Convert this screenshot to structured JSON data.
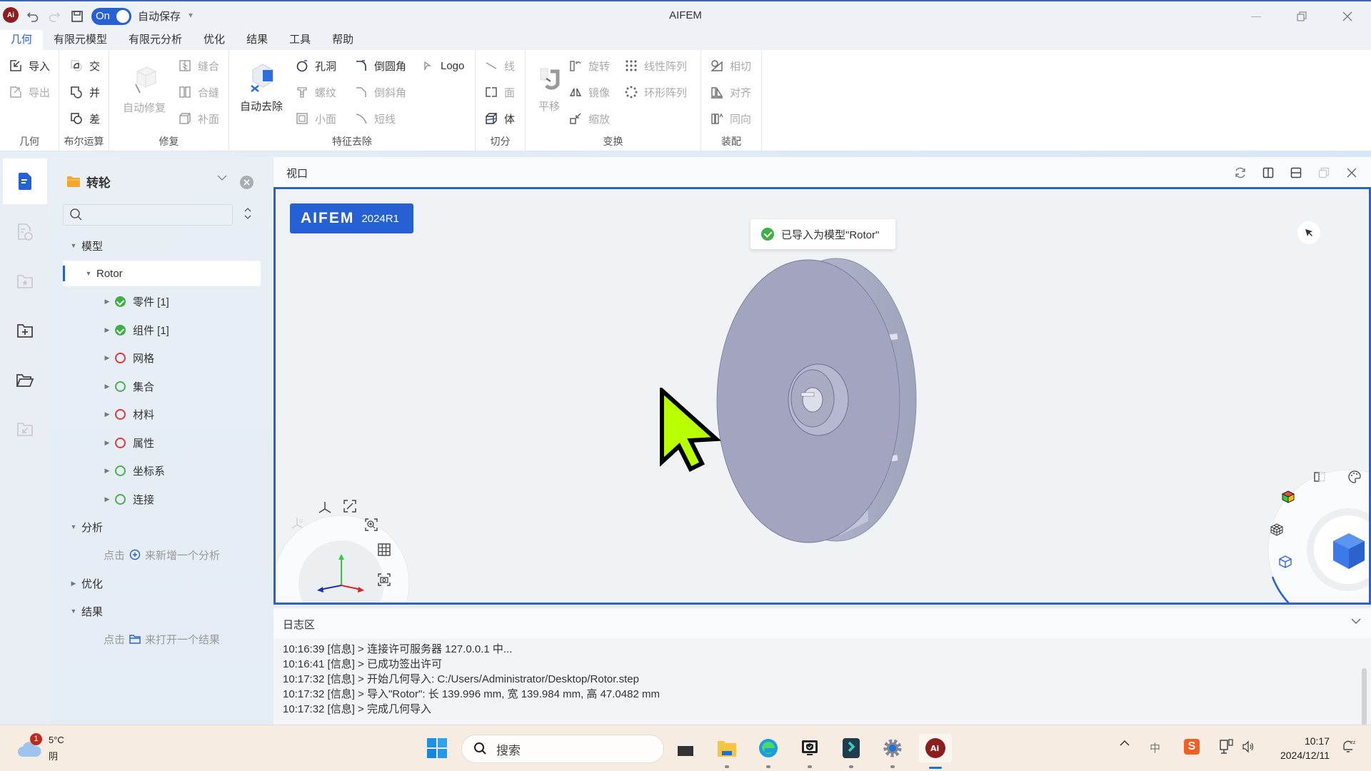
{
  "titlebar": {
    "app_title": "AIFEM",
    "autosave_toggle": "On",
    "autosave_label": "自动保存"
  },
  "menu": [
    "几何",
    "有限元模型",
    "有限元分析",
    "优化",
    "结果",
    "工具",
    "帮助"
  ],
  "ribbon": {
    "geometry": {
      "label": "几何",
      "import": "导入",
      "export": "导出"
    },
    "boolean": {
      "label": "布尔运算",
      "intersect": "交",
      "union": "并",
      "subtract": "差"
    },
    "repair": {
      "label": "修复",
      "auto_repair": "自动修复",
      "stitch": "缝合",
      "merge_seam": "合缝",
      "patch": "补面"
    },
    "feature_removal": {
      "label": "特征去除",
      "auto_remove": "自动去除",
      "hole": "孔洞",
      "thread": "螺纹",
      "small_face": "小面",
      "fillet": "倒圆角",
      "chamfer": "倒斜角",
      "short_edge": "短线",
      "logo": "Logo"
    },
    "split": {
      "label": "切分",
      "line": "线",
      "face": "面",
      "body": "体"
    },
    "transform": {
      "label": "变换",
      "translate": "平移",
      "rotate": "旋转",
      "mirror": "镜像",
      "scale": "缩放",
      "linear_array": "线性阵列",
      "circular_array": "环形阵列"
    },
    "assembly": {
      "label": "装配",
      "tangent": "相切",
      "align": "对齐",
      "same_direction": "同向"
    }
  },
  "tree": {
    "project": "转轮",
    "search_placeholder": "",
    "model_section": "模型",
    "root": "Rotor",
    "children": [
      {
        "label": "零件 [1]",
        "status": "ok"
      },
      {
        "label": "组件 [1]",
        "status": "ok"
      },
      {
        "label": "网格",
        "status": "red"
      },
      {
        "label": "集合",
        "status": "green"
      },
      {
        "label": "材料",
        "status": "red"
      },
      {
        "label": "属性",
        "status": "red"
      },
      {
        "label": "坐标系",
        "status": "green"
      },
      {
        "label": "连接",
        "status": "green"
      }
    ],
    "analysis_section": "分析",
    "analysis_hint_pre": "点击",
    "analysis_hint_post": "来新增一个分析",
    "optimization_section": "优化",
    "results_section": "结果",
    "results_hint_pre": "点击",
    "results_hint_post": "来打开一个结果"
  },
  "viewport": {
    "title": "视口",
    "brand_name": "AIFEM",
    "brand_version": "2024R1",
    "toast": "已导入为模型\"Rotor\""
  },
  "log": {
    "title": "日志区",
    "lines": [
      "10:16:39 [信息] > 连接许可服务器 127.0.0.1 中...",
      "10:16:41 [信息] > 已成功签出许可",
      "10:17:32 [信息] > 开始几何导入: C:/Users/Administrator/Desktop/Rotor.step",
      "10:17:32 [信息] > 导入\"Rotor\": 长 139.996 mm, 宽 139.984 mm, 高 47.0482 mm",
      "10:17:32 [信息] > 完成几何导入"
    ]
  },
  "taskbar": {
    "weather_temp": "5°C",
    "weather_desc": "阴",
    "weather_badge": "1",
    "search_placeholder": "搜索",
    "time": "10:17",
    "date": "2024/12/11",
    "ime": "中"
  },
  "colors": {
    "accent": "#2561d4",
    "ok": "#3cb043",
    "error": "#e03a3a"
  }
}
